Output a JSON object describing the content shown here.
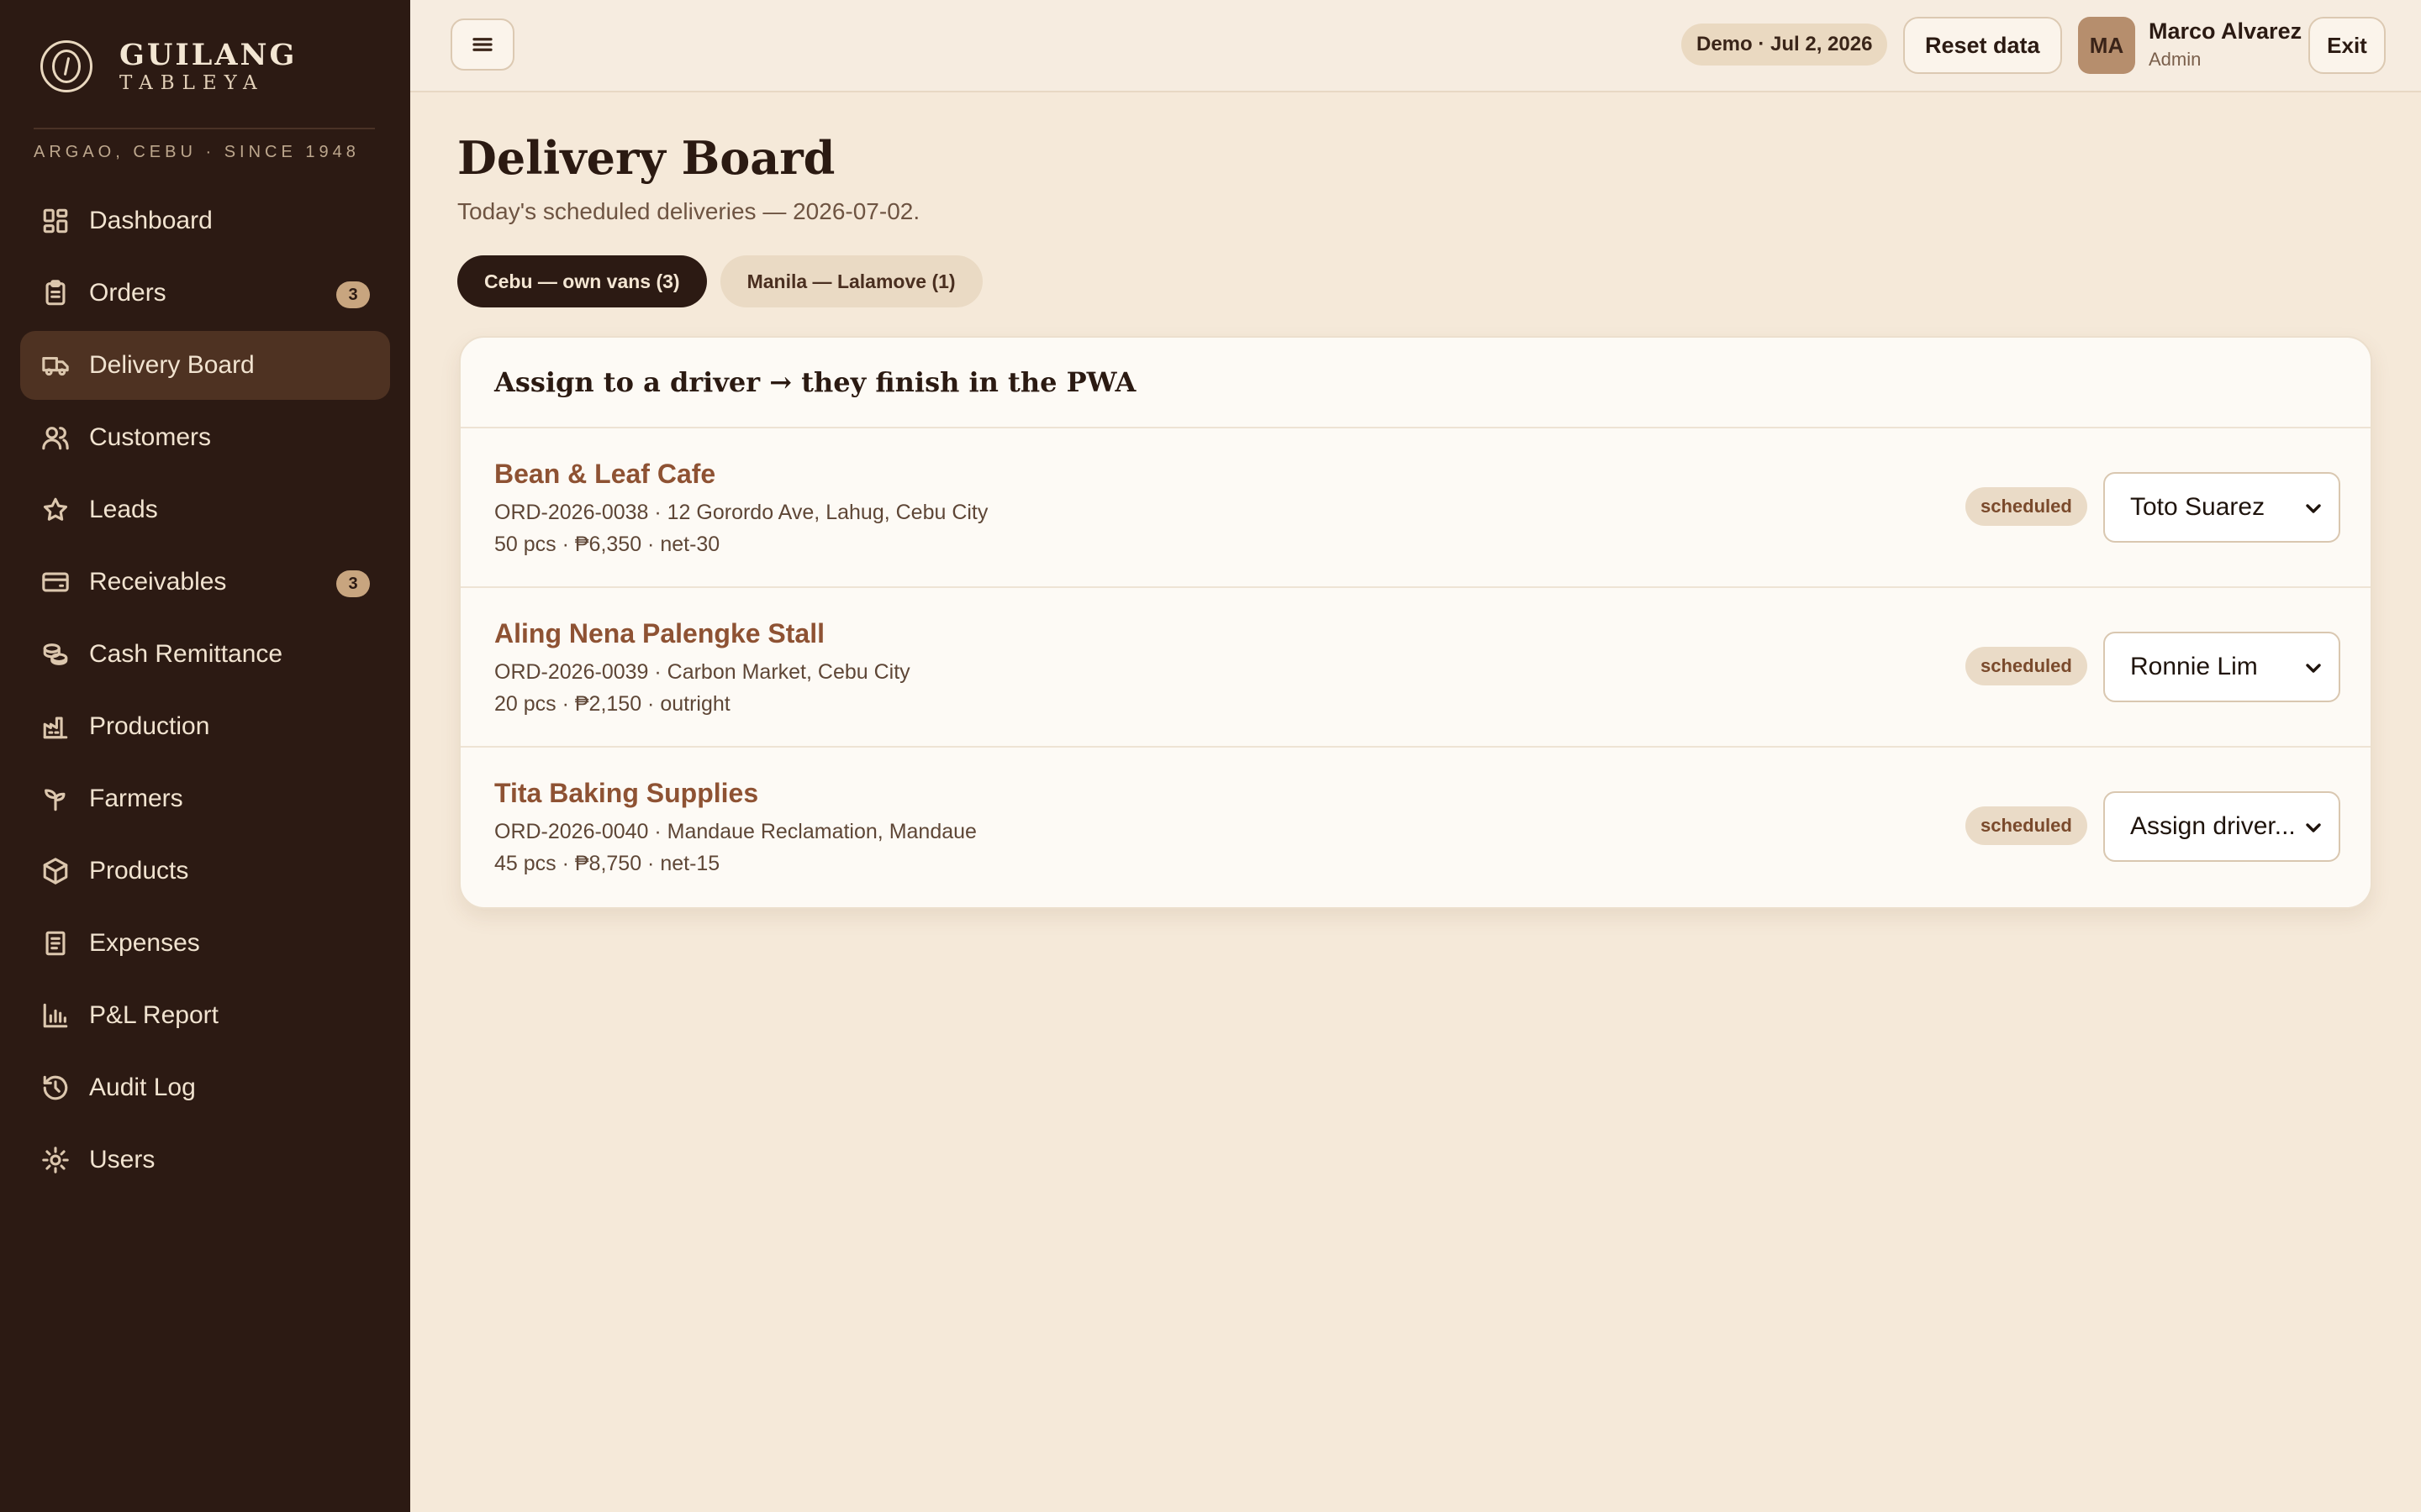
{
  "brand": {
    "name": "GUILANG",
    "sub": "TABLEYA",
    "tagline": "ARGAO, CEBU · SINCE 1948"
  },
  "sidebar": {
    "items": [
      {
        "label": "Dashboard",
        "icon": "dashboard-icon",
        "badge": ""
      },
      {
        "label": "Orders",
        "icon": "clipboard-icon",
        "badge": "3"
      },
      {
        "label": "Delivery Board",
        "icon": "truck-icon",
        "badge": "",
        "active": true
      },
      {
        "label": "Customers",
        "icon": "customers-icon",
        "badge": ""
      },
      {
        "label": "Leads",
        "icon": "star-icon",
        "badge": ""
      },
      {
        "label": "Receivables",
        "icon": "card-icon",
        "badge": "3"
      },
      {
        "label": "Cash Remittance",
        "icon": "coins-icon",
        "badge": ""
      },
      {
        "label": "Production",
        "icon": "factory-icon",
        "badge": ""
      },
      {
        "label": "Farmers",
        "icon": "sprout-icon",
        "badge": ""
      },
      {
        "label": "Products",
        "icon": "box-icon",
        "badge": ""
      },
      {
        "label": "Expenses",
        "icon": "receipt-icon",
        "badge": ""
      },
      {
        "label": "P&L Report",
        "icon": "bar-chart-icon",
        "badge": ""
      },
      {
        "label": "Audit Log",
        "icon": "history-icon",
        "badge": ""
      },
      {
        "label": "Users",
        "icon": "gear-icon",
        "badge": ""
      }
    ]
  },
  "topbar": {
    "demo": "Demo · Jul 2, 2026",
    "reset": "Reset data",
    "avatar_initials": "MA",
    "user_name": "Marco Alvarez",
    "user_role": "Admin",
    "exit": "Exit"
  },
  "page": {
    "title": "Delivery Board",
    "subtitle": "Today's scheduled deliveries — 2026-07-02.",
    "tabs": [
      {
        "label": "Cebu — own vans (3)",
        "active": true
      },
      {
        "label": "Manila — Lalamove (1)",
        "active": false
      }
    ]
  },
  "card": {
    "title": "Assign to a driver → they finish in the PWA",
    "rows": [
      {
        "name": "Bean & Leaf Cafe",
        "line1": "ORD-2026-0038 · 12 Gorordo Ave, Lahug, Cebu City",
        "line2": "50 pcs · ₱6,350 · net-30",
        "status": "scheduled",
        "driver": "Toto Suarez"
      },
      {
        "name": "Aling Nena Palengke Stall",
        "line1": "ORD-2026-0039 · Carbon Market, Cebu City",
        "line2": "20 pcs · ₱2,150 · outright",
        "status": "scheduled",
        "driver": "Ronnie Lim"
      },
      {
        "name": "Tita Baking Supplies",
        "line1": "ORD-2026-0040 · Mandaue Reclamation, Mandaue",
        "line2": "45 pcs · ₱8,750 · net-15",
        "status": "scheduled",
        "driver": "Assign driver..."
      }
    ]
  },
  "colors": {
    "sidebar_bg": "#2c1a13",
    "page_bg": "#f5e9d9",
    "accent_link": "#8e5233",
    "active_item": "#4e3222"
  }
}
